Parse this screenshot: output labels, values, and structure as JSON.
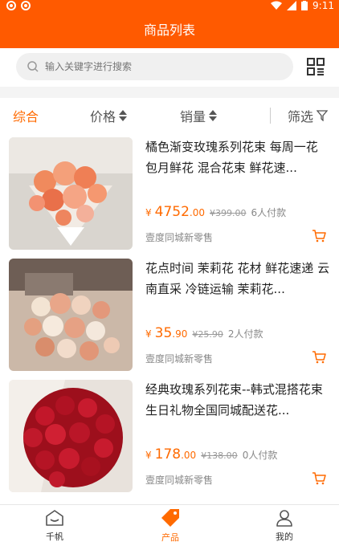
{
  "status_bar": {
    "time": "9:11"
  },
  "header": {
    "title": "商品列表"
  },
  "search": {
    "placeholder": "输入关键字进行搜索"
  },
  "filters": {
    "comprehensive": "综合",
    "price": "价格",
    "sales": "销量",
    "filter": "筛选"
  },
  "products": [
    {
      "title": "橘色渐变玫瑰系列花束 每周一花 包月鲜花 混合花束 鲜花速...",
      "price_symbol": "¥",
      "price_int": "4752",
      "price_dec": ".00",
      "old_price": "¥399.00",
      "pay_count": "6人付款",
      "shop": "壹度同城新零售"
    },
    {
      "title": "花点时间 茉莉花 花材 鲜花速递 云南直采 冷链运输 茉莉花...",
      "price_symbol": "¥",
      "price_int": "35",
      "price_dec": ".90",
      "old_price": "¥25.90",
      "pay_count": "2人付款",
      "shop": "壹度同城新零售"
    },
    {
      "title": "经典玫瑰系列花束--韩式混搭花束生日礼物全国同城配送花...",
      "price_symbol": "¥",
      "price_int": "178",
      "price_dec": ".00",
      "old_price": "¥138.00",
      "pay_count": "0人付款",
      "shop": "壹度同城新零售"
    }
  ],
  "tabs": [
    {
      "label": "千帆"
    },
    {
      "label": "产品"
    },
    {
      "label": "我的"
    }
  ],
  "colors": {
    "accent": "#ff5a00",
    "price": "#ff6a00"
  }
}
